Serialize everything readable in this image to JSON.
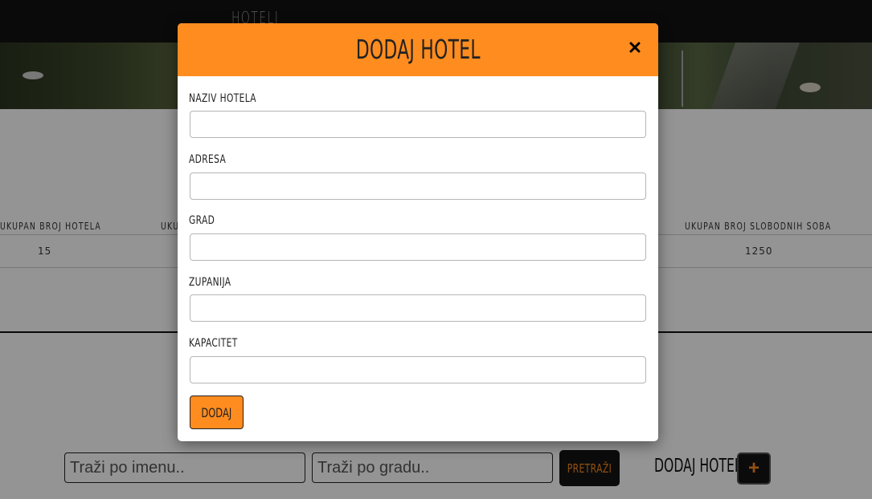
{
  "nav": {
    "title": "HOTELI"
  },
  "stats": [
    {
      "label": "UKUPAN BROJ HOTELA",
      "value": "15"
    },
    {
      "label": "UKU",
      "value": ""
    },
    {
      "label": "UKUPAN BROJ SLOBODNIH SOBA",
      "value": "1250"
    }
  ],
  "search": {
    "name_placeholder": "Traži po imenu..",
    "city_placeholder": "Traži po gradu..",
    "search_button": "PRETRAŽI",
    "add_label": "DODAJ HOTEL",
    "add_button": "+"
  },
  "modal": {
    "title": "DODAJ HOTEL",
    "close_icon": "close-icon",
    "fields": [
      {
        "label": "NAZIV HOTELA",
        "value": ""
      },
      {
        "label": "ADRESA",
        "value": ""
      },
      {
        "label": "GRAD",
        "value": ""
      },
      {
        "label": "ZUPANIJA",
        "value": ""
      },
      {
        "label": "KAPACITET",
        "value": ""
      }
    ],
    "submit_label": "DODAJ"
  },
  "colors": {
    "accent": "#ff8c1f",
    "dark": "#141414"
  }
}
